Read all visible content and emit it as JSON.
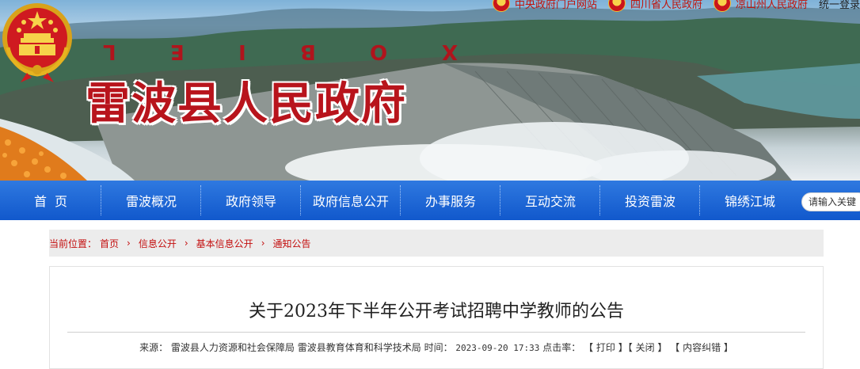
{
  "header": {
    "top_links": [
      {
        "label": "中央政府门户网站"
      },
      {
        "label": "四川省人民政府"
      },
      {
        "label": "凉山州人民政府"
      }
    ],
    "login_label": "统一登录",
    "pinyin_letters": [
      "L",
      "E",
      "I",
      "B",
      "O",
      "X"
    ],
    "site_title": "雷波县人民政府"
  },
  "nav": {
    "items": [
      {
        "label": "首页"
      },
      {
        "label": "雷波概况"
      },
      {
        "label": "政府领导"
      },
      {
        "label": "政府信息公开"
      },
      {
        "label": "办事服务"
      },
      {
        "label": "互动交流"
      },
      {
        "label": "投资雷波"
      },
      {
        "label": "锦绣江城"
      }
    ],
    "search_placeholder": "请输入关键"
  },
  "breadcrumb": {
    "label": "当前位置：",
    "items": [
      "首页",
      "信息公开",
      "基本信息公开",
      "通知公告"
    ]
  },
  "article": {
    "title": "关于2023年下半年公开考试招聘中学教师的公告",
    "source_label": "来源：",
    "source": "雷波县人力资源和社会保障局 雷波县教育体育和科学技术局",
    "time_label": "时间：",
    "time": "2023-09-20 17:33",
    "hits_label": "点击率：",
    "print_label": "打印",
    "close_label": "关闭",
    "error_label": "内容纠错"
  },
  "colors": {
    "nav_blue": "#1a63d6",
    "title_red": "#b8141c",
    "breadcrumb_red": "#c30d0d"
  }
}
